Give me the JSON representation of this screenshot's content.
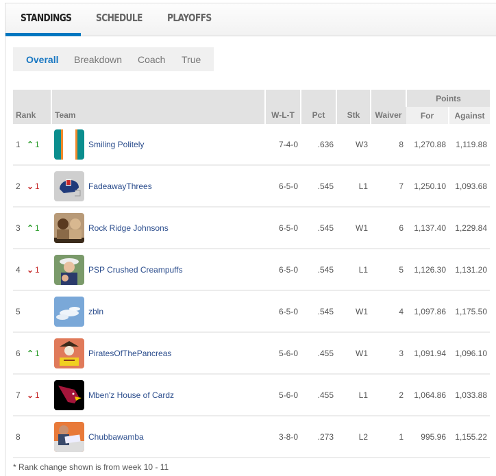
{
  "top_tabs": [
    {
      "label": "STANDINGS",
      "active": true
    },
    {
      "label": "SCHEDULE",
      "active": false
    },
    {
      "label": "PLAYOFFS",
      "active": false
    }
  ],
  "sub_tabs": [
    {
      "label": "Overall",
      "active": true
    },
    {
      "label": "Breakdown",
      "active": false
    },
    {
      "label": "Coach",
      "active": false
    },
    {
      "label": "True",
      "active": false
    }
  ],
  "table": {
    "group_header": "Points",
    "headers": {
      "rank": "Rank",
      "team": "Team",
      "wlt": "W-L-T",
      "pct": "Pct",
      "stk": "Stk",
      "waiver": "Waiver",
      "for": "For",
      "against": "Against"
    },
    "rows": [
      {
        "rank": "1",
        "change_dir": "up",
        "change": "1",
        "avatar": "dolphins-stripes-avatar",
        "team": "Smiling Politely",
        "wlt": "7-4-0",
        "pct": ".636",
        "stk": "W3",
        "waiver": "8",
        "for": "1,270.88",
        "against": "1,119.88"
      },
      {
        "rank": "2",
        "change_dir": "down",
        "change": "1",
        "avatar": "nfl-helmet-avatar",
        "team": "FadeawayThrees",
        "wlt": "6-5-0",
        "pct": ".545",
        "stk": "L1",
        "waiver": "7",
        "for": "1,250.10",
        "against": "1,093.68"
      },
      {
        "rank": "3",
        "change_dir": "up",
        "change": "1",
        "avatar": "photo-two-men-avatar",
        "team": "Rock Ridge Johnsons",
        "wlt": "6-5-0",
        "pct": ".545",
        "stk": "W1",
        "waiver": "6",
        "for": "1,137.40",
        "against": "1,229.84"
      },
      {
        "rank": "4",
        "change_dir": "down",
        "change": "1",
        "avatar": "photo-man-hat-avatar",
        "team": "PSP Crushed Creampuffs",
        "wlt": "6-5-0",
        "pct": ".545",
        "stk": "L1",
        "waiver": "5",
        "for": "1,126.30",
        "against": "1,131.20"
      },
      {
        "rank": "5",
        "change_dir": "",
        "change": "",
        "avatar": "sky-clouds-avatar",
        "team": "zbln",
        "wlt": "6-5-0",
        "pct": ".545",
        "stk": "W1",
        "waiver": "4",
        "for": "1,097.86",
        "against": "1,175.50"
      },
      {
        "rank": "6",
        "change_dir": "up",
        "change": "1",
        "avatar": "pirate-skull-avatar",
        "team": "PiratesOfThePancreas",
        "wlt": "5-6-0",
        "pct": ".455",
        "stk": "W1",
        "waiver": "3",
        "for": "1,091.94",
        "against": "1,096.10"
      },
      {
        "rank": "7",
        "change_dir": "down",
        "change": "1",
        "avatar": "cardinals-logo-avatar",
        "team": "Mben'z House of Cardz",
        "wlt": "5-6-0",
        "pct": ".455",
        "stk": "L1",
        "waiver": "2",
        "for": "1,064.86",
        "against": "1,033.88"
      },
      {
        "rank": "8",
        "change_dir": "",
        "change": "",
        "avatar": "photo-man-sign-avatar",
        "team": "Chubbawamba",
        "wlt": "3-8-0",
        "pct": ".273",
        "stk": "L2",
        "waiver": "1",
        "for": "995.96",
        "against": "1,155.22"
      }
    ]
  },
  "footnote": "* Rank change shown is from week 10 - 11",
  "colors": {
    "accent": "#0077c0",
    "active_sub": "#1a78c2",
    "up": "#2a9c2a",
    "down": "#c62828",
    "team_link": "#2a4c8c"
  }
}
